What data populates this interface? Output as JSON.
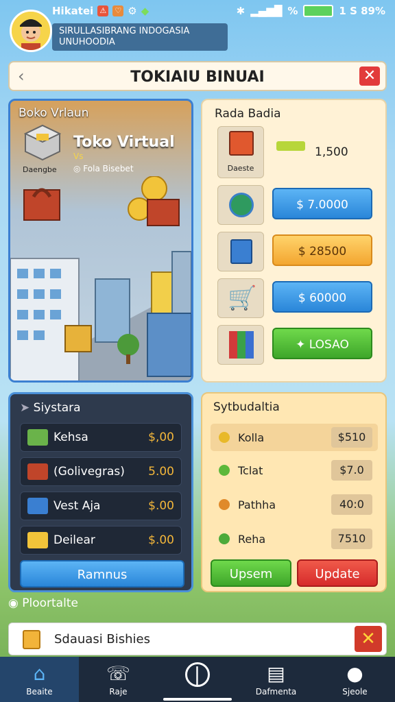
{
  "status_bar": {
    "carrier": "Hikatei",
    "badge_1": "⚠",
    "badge_2": "♡",
    "time_battery": "1 S 89%"
  },
  "profile": {
    "line1": "SIRULLASIBRANG INDOGASIA",
    "line2": "UNUHOODIA"
  },
  "header": {
    "title": "TOKIAIU BINUAI",
    "back_glyph": "‹",
    "close_glyph": "✕"
  },
  "city_panel": {
    "title": "Boko Vrlaun",
    "store_name": "Toko Virtual",
    "vs_label": "Vs",
    "subtitle": "Fola Bisebet",
    "crate_label": "Daengbe"
  },
  "shop_panel": {
    "title": "Rada Badia",
    "items": [
      {
        "label": "Daeste",
        "value": "1,500",
        "icon": "crate-icon"
      },
      {
        "button": "$ 7.0000",
        "style": "blue",
        "icon": "coin-icon"
      },
      {
        "button": "$ 28500",
        "style": "orange",
        "icon": "dice-icon"
      },
      {
        "button": "$ 60000",
        "style": "blue",
        "icon": "cart-icon"
      },
      {
        "button": "✦ LOSAO",
        "style": "green",
        "icon": "books-icon"
      }
    ]
  },
  "system_panel": {
    "title": "Siystara",
    "rows": [
      {
        "name": "Kehsa",
        "value": "$,00",
        "icon": "cash-icon"
      },
      {
        "name": "(Golivegras)",
        "value": "5.00",
        "icon": "chest-icon"
      },
      {
        "name": "Vest Aja",
        "value": "$.00",
        "icon": "truck-icon"
      },
      {
        "name": "Deilear",
        "value": "$.00",
        "icon": "gold-icon"
      }
    ],
    "button": "Ramnus"
  },
  "stats_panel": {
    "title": "Sytbudaltia",
    "rows": [
      {
        "name": "Kolla",
        "value": "$510"
      },
      {
        "name": "Tclat",
        "value": "$7.0"
      },
      {
        "name": "Pathha",
        "value": "40:0"
      },
      {
        "name": "Reha",
        "value": "7510"
      }
    ],
    "upsem_button": "Upsem",
    "update_button": "Update"
  },
  "hint": "Ploortalte",
  "notification": {
    "text": "Sdauasi Bishies"
  },
  "nav": [
    {
      "label": "Beaite",
      "icon": "home-icon"
    },
    {
      "label": "Raje",
      "icon": "dial-icon"
    },
    {
      "label": "",
      "icon": "power-icon"
    },
    {
      "label": "Dafmenta",
      "icon": "map-icon"
    },
    {
      "label": "Sjeole",
      "icon": "user-icon"
    }
  ],
  "colors": {
    "accent_blue": "#2a86d9",
    "accent_green": "#3ea62a",
    "accent_red": "#d62b2b",
    "accent_orange": "#f3a630",
    "gold": "#f4b73a"
  }
}
